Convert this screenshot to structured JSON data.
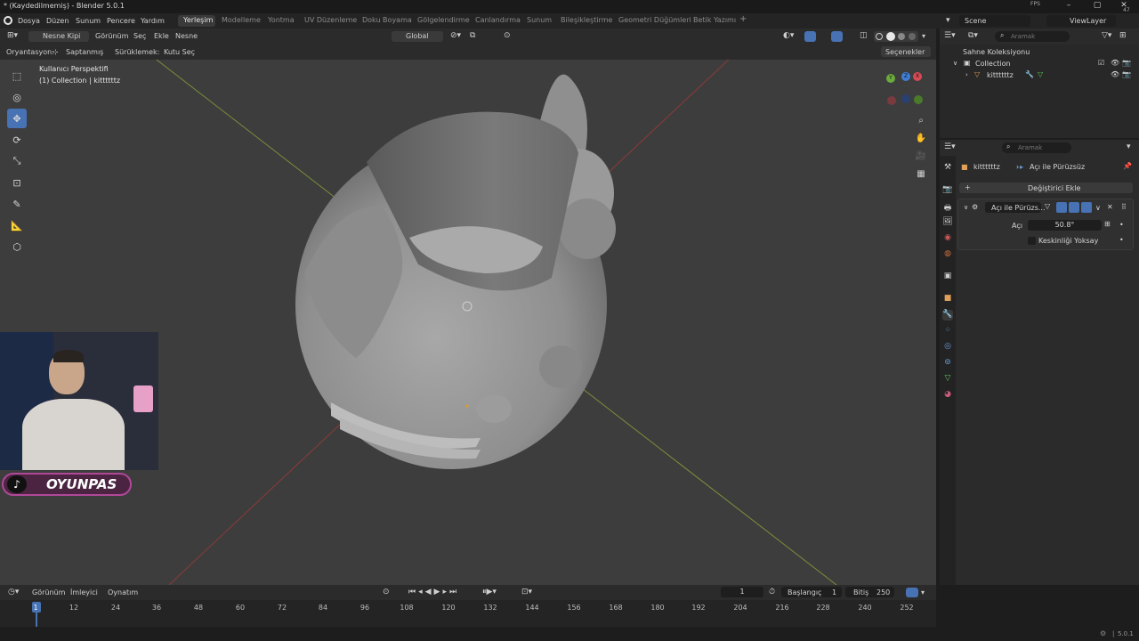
{
  "window": {
    "title": "* (Kaydedilmemiş) - Blender 5.0.1",
    "fps_label": "FPS",
    "fps_value": "47"
  },
  "menus": [
    "Dosya",
    "Düzen",
    "Sunum",
    "Pencere",
    "Yardım"
  ],
  "workspaces": [
    "Yerleşim",
    "Modelleme",
    "Yontma",
    "UV Düzenleme",
    "Doku Boyama",
    "Gölgelendirme",
    "Canlandırma",
    "Sunum",
    "Bileşikleştirme",
    "Geometri Düğümleri",
    "Betik Yazımı"
  ],
  "active_workspace": "Yerleşim",
  "scene": {
    "name": "Scene",
    "view_layer": "ViewLayer"
  },
  "viewport_header": {
    "mode": "Nesne Kipi",
    "menus": [
      "Görünüm",
      "Seç",
      "Ekle",
      "Nesne"
    ],
    "transform": "Global"
  },
  "viewport_header2": {
    "orientation_label": "Oryantasyon:",
    "orientation_value": "Saptanmış",
    "drag_label": "Sürüklemek:",
    "drag_value": "Kutu Seç",
    "options": "Seçenekler"
  },
  "viewport_overlay": {
    "view_name": "Kullanıcı Perspektifi",
    "collection_info": "(1) Collection | kittttttz"
  },
  "gizmo": {
    "z": "Z",
    "y": "Y",
    "x": "X"
  },
  "outliner": {
    "search_placeholder": "Aramak",
    "root": "Sahne Koleksiyonu",
    "collection": "Collection",
    "object": "kittttttz"
  },
  "properties": {
    "search_placeholder": "Aramak",
    "object": "kittttttz",
    "modifier_breadcrumb": "Açı ile Pürüzsüz",
    "add_modifier": "Değiştirici Ekle",
    "modifier_name": "Açı ile Pürüzs...",
    "angle_label": "Açı",
    "angle_value": "50.8°",
    "ignore_sharpness": "Keskinliği Yoksay"
  },
  "timeline_header": {
    "menus": [
      "Görünüm",
      "İmleyici",
      "Oynatım"
    ],
    "current_frame": "1",
    "start_label": "Başlangıç",
    "start": "1",
    "end_label": "Bitiş",
    "end": "250"
  },
  "timeline_ticks": [
    "1",
    "12",
    "24",
    "36",
    "48",
    "60",
    "72",
    "84",
    "96",
    "108",
    "120",
    "132",
    "144",
    "156",
    "168",
    "180",
    "192",
    "204",
    "216",
    "228",
    "240",
    "252"
  ],
  "status": {
    "version": "5.0.1"
  },
  "streamer": {
    "handle": "OYUNPAS"
  }
}
